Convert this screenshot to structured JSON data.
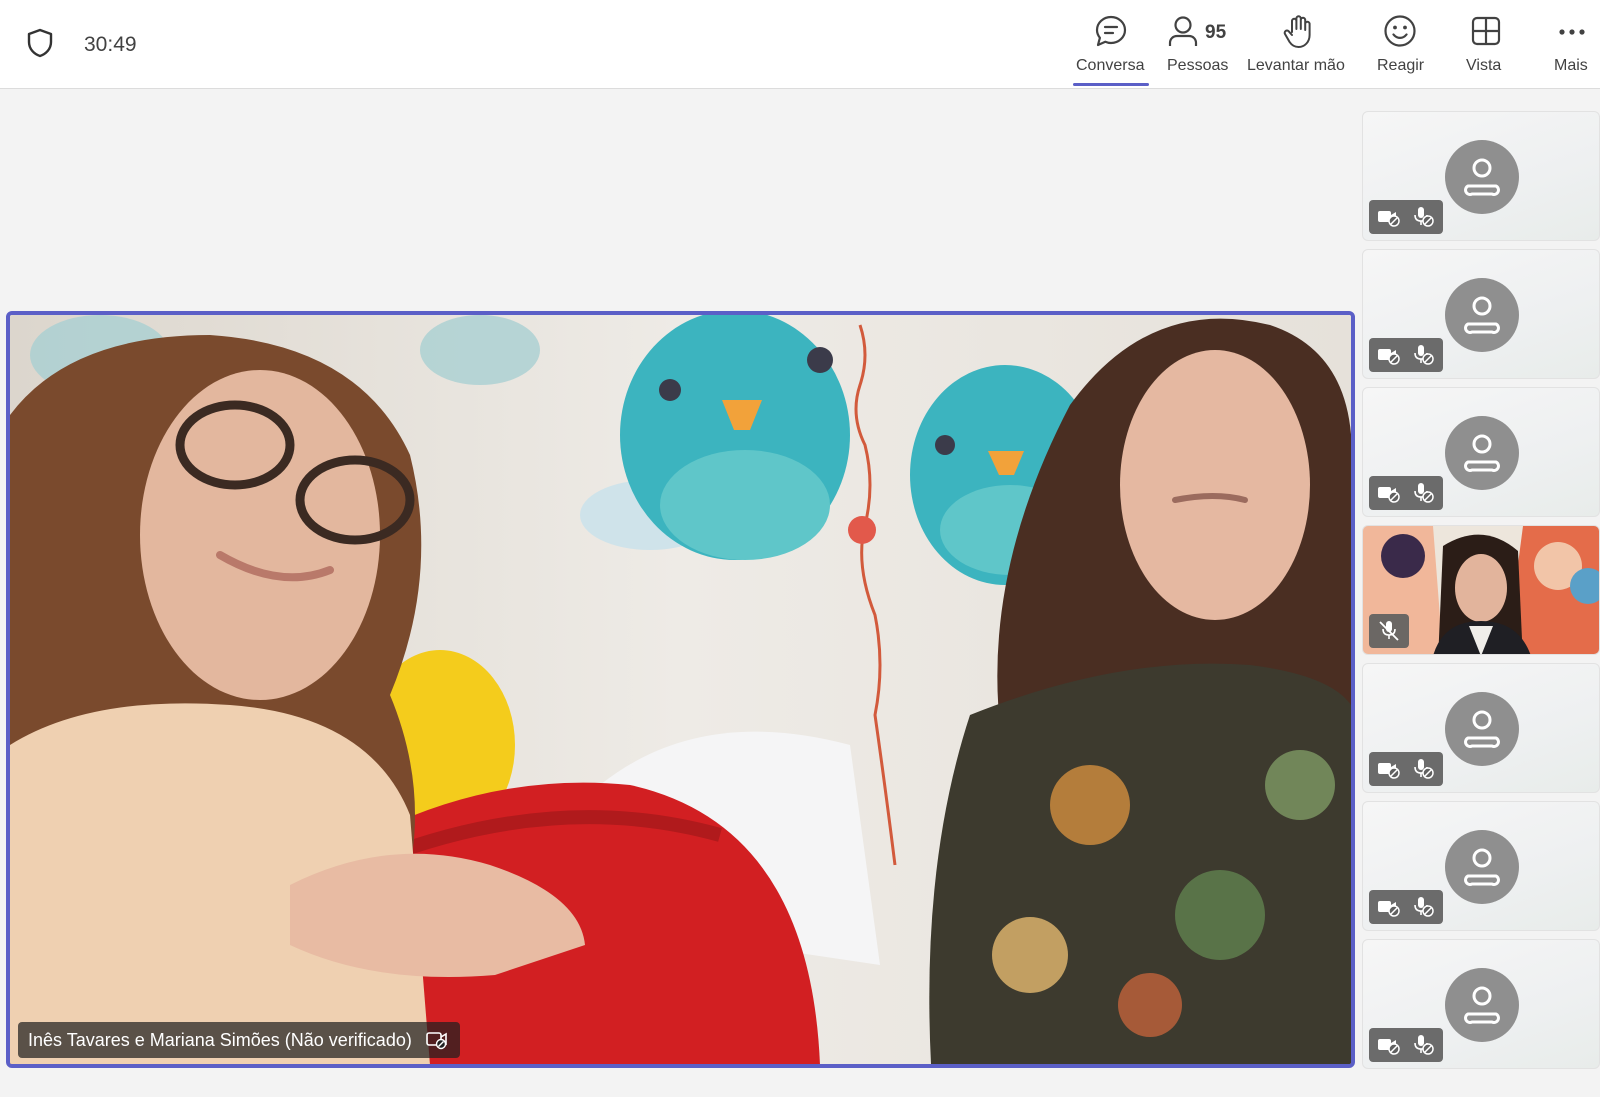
{
  "header": {
    "timer": "30:49",
    "shield_icon": "shield-icon",
    "tools": [
      {
        "id": "chat",
        "label": "Conversa",
        "icon": "chat-icon",
        "active": true
      },
      {
        "id": "people",
        "label": "Pessoas",
        "icon": "person-icon",
        "count": "95"
      },
      {
        "id": "raise-hand",
        "label": "Levantar mão",
        "icon": "hand-icon"
      },
      {
        "id": "react",
        "label": "Reagir",
        "icon": "smiley-icon"
      },
      {
        "id": "view",
        "label": "Vista",
        "icon": "grid-icon"
      },
      {
        "id": "more",
        "label": "Mais",
        "icon": "more-icon"
      }
    ]
  },
  "main_video": {
    "participant_name": "Inês Tavares e Mariana Simões (Não verificado)",
    "badge_icon": "camera-slash-icon"
  },
  "side_tiles": [
    {
      "type": "avatar",
      "camera": "off",
      "mic": "off"
    },
    {
      "type": "avatar",
      "camera": "off",
      "mic": "off"
    },
    {
      "type": "avatar",
      "camera": "off",
      "mic": "off"
    },
    {
      "type": "video",
      "mic": "off"
    },
    {
      "type": "avatar",
      "camera": "off",
      "mic": "off"
    },
    {
      "type": "avatar",
      "camera": "off",
      "mic": "off"
    },
    {
      "type": "avatar",
      "camera": "off",
      "mic": "off"
    }
  ],
  "colors": {
    "accent": "#5b5fc7",
    "avatar_bg": "#8f8f8f",
    "stage_bg": "#f3f3f3"
  }
}
